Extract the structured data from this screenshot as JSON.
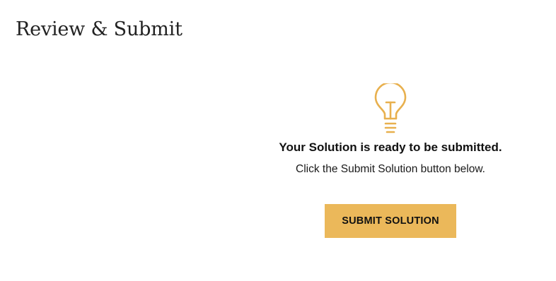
{
  "page": {
    "title": "Review & Submit"
  },
  "status": {
    "icon": "lightbulb-icon",
    "headline": "Your Solution is ready to be submitted.",
    "instruction": "Click the Submit Solution button below."
  },
  "actions": {
    "submit_label": "SUBMIT SOLUTION"
  },
  "colors": {
    "accent": "#ebb85a",
    "icon": "#e8b04e",
    "text": "#111111"
  }
}
